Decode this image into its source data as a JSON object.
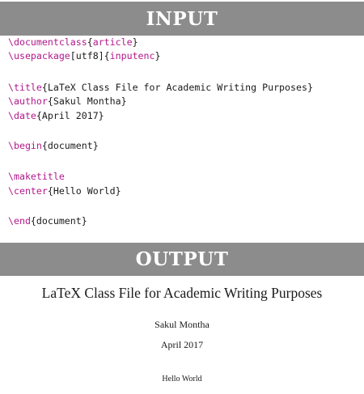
{
  "labels": {
    "input": "INPUT",
    "output": "OUTPUT"
  },
  "code": {
    "l1": {
      "cmd": "\\documentclass",
      "o1": "{",
      "arg": "article",
      "o2": "}"
    },
    "l2": {
      "cmd": "\\usepackage",
      "opt": "[utf8]",
      "o1": "{",
      "arg": "inputenc",
      "o2": "}"
    },
    "l3": {
      "cmd": "\\title",
      "rest": "{LaTeX Class File for Academic Writing Purposes}"
    },
    "l4": {
      "cmd": "\\author",
      "rest": "{Sakul Montha}"
    },
    "l5": {
      "cmd": "\\date",
      "rest": "{April 2017}"
    },
    "l6": {
      "cmd": "\\begin",
      "rest": "{document}"
    },
    "l7": {
      "cmd": "\\maketitle"
    },
    "l8": {
      "cmd": "\\center",
      "rest": "{Hello World}"
    },
    "l9": {
      "cmd": "\\end",
      "rest": "{document}"
    }
  },
  "output": {
    "title": "LaTeX Class File for Academic Writing Purposes",
    "author": "Sakul Montha",
    "date": "April 2017",
    "body": "Hello World"
  }
}
